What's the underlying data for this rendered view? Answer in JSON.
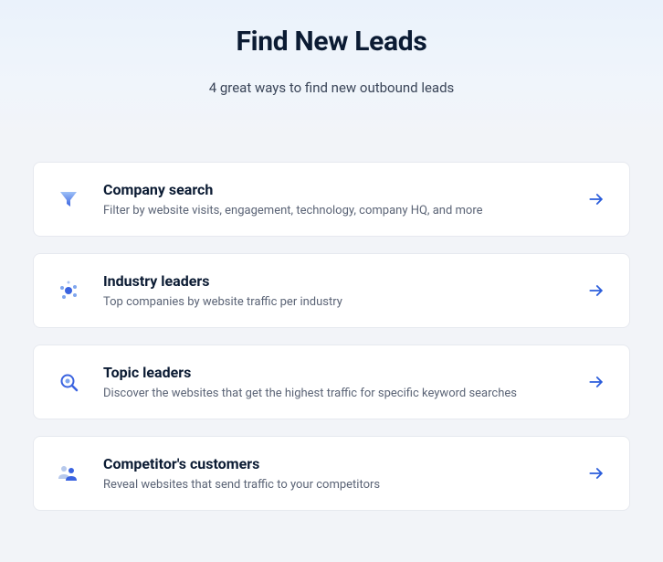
{
  "hero": {
    "title": "Find New Leads",
    "subtitle": "4 great ways to find new outbound leads"
  },
  "cards": [
    {
      "icon": "funnel-icon",
      "title": "Company search",
      "desc": "Filter by website visits, engagement, technology, company HQ, and more"
    },
    {
      "icon": "network-icon",
      "title": "Industry leaders",
      "desc": "Top companies by website traffic per industry"
    },
    {
      "icon": "magnify-icon",
      "title": "Topic leaders",
      "desc": "Discover the websites that get the highest traffic for specific keyword searches"
    },
    {
      "icon": "people-icon",
      "title": "Competitor's customers",
      "desc": "Reveal websites that send traffic to your competitors"
    }
  ]
}
